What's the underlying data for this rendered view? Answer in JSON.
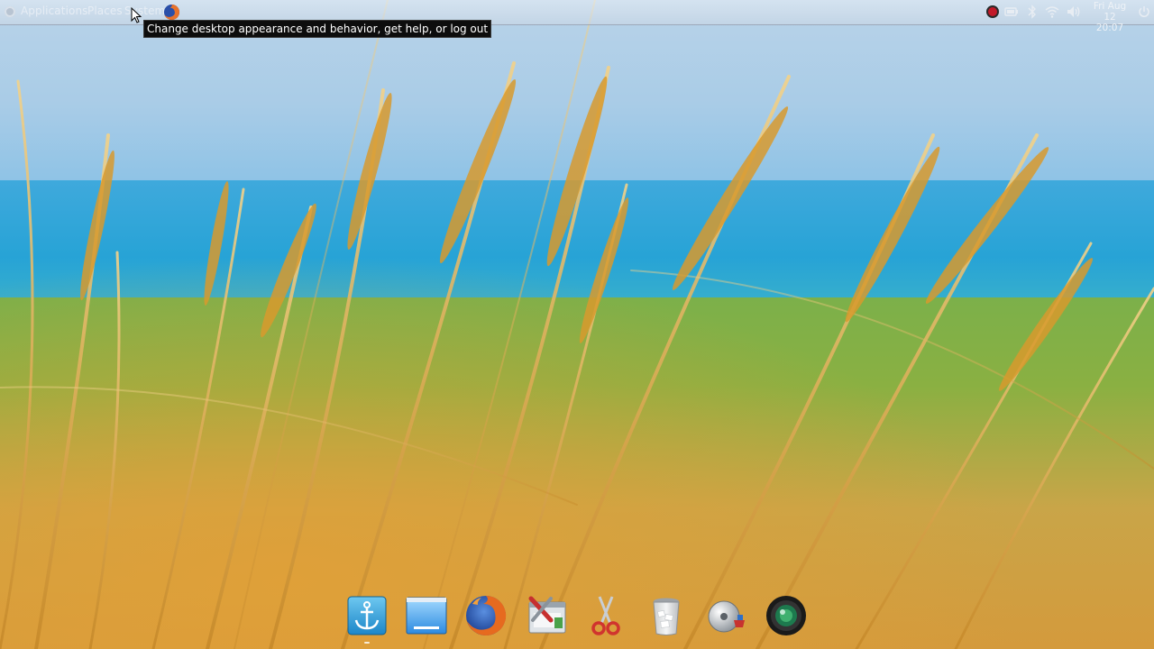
{
  "panel": {
    "menus": {
      "applications": "Applications",
      "places": "Places",
      "system": "System"
    },
    "launcher_icon": "firefox-icon",
    "tray_icons": [
      "record-icon",
      "battery-icon",
      "bluetooth-icon",
      "wifi-icon",
      "volume-icon",
      "power-icon"
    ],
    "clock": {
      "date": "Fri Aug 12",
      "time": "20:07"
    }
  },
  "tooltip": {
    "text": "Change desktop appearance and behavior, get help, or log out"
  },
  "dock": {
    "items": [
      {
        "name": "anchor-launcher",
        "icon": "anchor-icon"
      },
      {
        "name": "show-desktop",
        "icon": "desktop-window-icon"
      },
      {
        "name": "firefox",
        "icon": "firefox-icon"
      },
      {
        "name": "system-tools",
        "icon": "tools-icon"
      },
      {
        "name": "screenshot",
        "icon": "scissors-icon"
      },
      {
        "name": "trash",
        "icon": "trash-icon"
      },
      {
        "name": "disk-utility",
        "icon": "disk-icon"
      },
      {
        "name": "camera",
        "icon": "camera-lens-icon"
      }
    ]
  },
  "colors": {
    "panel": "#d7dee8",
    "tooltip_bg": "#0d0d0d",
    "tooltip_fg": "#ffffff",
    "record": "#c21a2a"
  }
}
